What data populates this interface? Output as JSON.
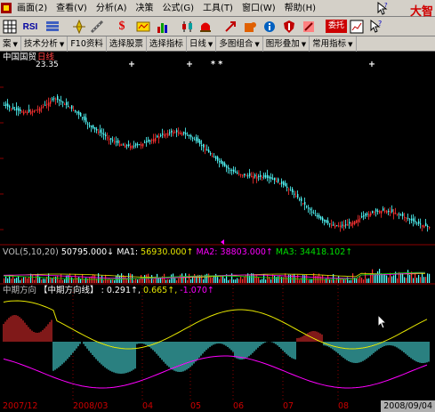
{
  "menu": {
    "items": [
      "画面(2)",
      "查看(V)",
      "分析(A)",
      "决策",
      "公式(G)",
      "工具(T)",
      "窗口(W)",
      "帮助(H)"
    ],
    "brand": "大智"
  },
  "toolbar": {
    "icons": [
      "grid-icon",
      "rsi-icon",
      "stack-icon",
      "compass-icon",
      "ruler-icon",
      "dollar-icon",
      "map-icon",
      "bars-icon",
      "candle-icon",
      "alarm-icon",
      "arrow-icon",
      "puzzle-icon",
      "info-icon",
      "shield-icon",
      "tools-icon",
      "graph-icon",
      "help-icon"
    ],
    "rsi_label": "RSI",
    "quote_tag": "委托",
    "dollar_label": "$"
  },
  "tabs": [
    {
      "label": "案",
      "arrow": "▼"
    },
    {
      "label": "技术分析",
      "arrow": "▼"
    },
    {
      "label": "F10资料",
      "arrow": ""
    },
    {
      "label": "选择股票",
      "arrow": ""
    },
    {
      "label": "选择指标",
      "arrow": ""
    },
    {
      "label": "日线",
      "arrow": "▼"
    },
    {
      "label": "多图组合",
      "arrow": "▼"
    },
    {
      "label": "图形叠加",
      "arrow": "▼"
    },
    {
      "label": "常用指标",
      "arrow": "▼"
    }
  ],
  "price_panel": {
    "stock": "中国国贸",
    "period": "日线",
    "high_marker": "23.35",
    "flags": [
      "+",
      "+",
      "* *",
      "+"
    ]
  },
  "volume_panel": {
    "title": "VOL(5,10,20)",
    "vol": "50795.000↓",
    "ma1_label": "MA1:",
    "ma1": "56930.000↑",
    "ma2_label": "MA2:",
    "ma2": "38803.000↑",
    "ma3_label": "MA3:",
    "ma3": "34418.102↑"
  },
  "indicator_panel": {
    "title": "中期方向",
    "name": "【中期方向线】",
    "v1": ": 0.291↑,",
    "v2": "0.665↑,",
    "v3": "-1.070↑"
  },
  "date_axis": {
    "ticks": [
      "2007/12",
      "2008/03",
      "04",
      "05",
      "06",
      "07",
      "08"
    ],
    "cursor": "2008/09/04"
  },
  "colors": {
    "up": "#ff3232",
    "down": "#54ffff",
    "ma_yellow": "#e6e600",
    "ma_magenta": "#ff00ff",
    "ma_green": "#00e000",
    "grid_red": "#8b0000"
  }
}
